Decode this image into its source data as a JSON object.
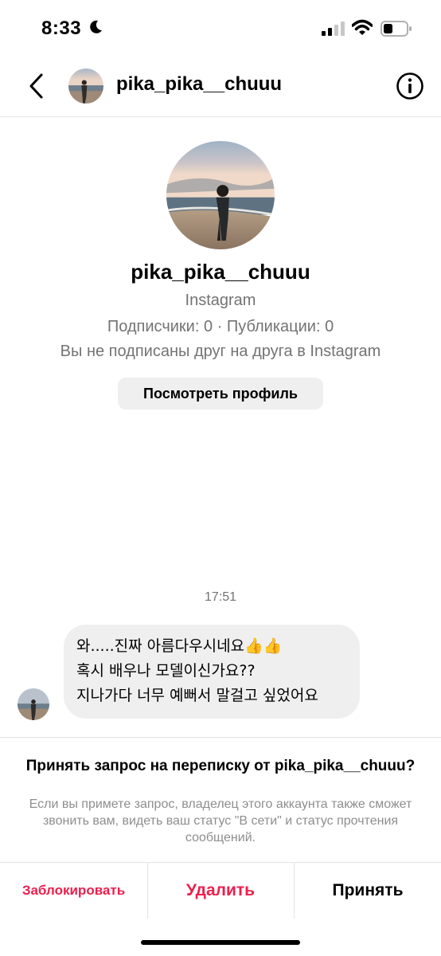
{
  "status_bar": {
    "time": "8:33",
    "icons": [
      "moon-icon",
      "cellular-signal-icon",
      "wifi-icon",
      "battery-icon"
    ]
  },
  "header": {
    "username": "pika_pika__chuuu",
    "icons": [
      "chevron-left-icon",
      "info-icon"
    ]
  },
  "profile": {
    "username": "pika_pika__chuuu",
    "platform": "Instagram",
    "stats": "Подписчики: 0 · Публикации: 0",
    "relation": "Вы не подписаны друг на друга в Instagram",
    "view_profile_label": "Посмотреть профиль"
  },
  "conversation": {
    "timestamp": "17:51",
    "message_lines": [
      "와.....진짜 아름다우시네요👍👍",
      "혹시 배우나 모델이신가요??",
      "지나가다 너무 예뻐서 말걸고 싶었어요"
    ]
  },
  "request_panel": {
    "title": "Принять запрос на переписку от pika_pika__chuuu?",
    "description": "Если вы примете запрос, владелец этого аккаунта также сможет звонить вам, видеть ваш статус \"В сети\" и статус прочтения сообщений.",
    "block_label": "Заблокировать",
    "delete_label": "Удалить",
    "accept_label": "Принять"
  },
  "colors": {
    "destructive": "#ed1f4d",
    "secondary_text": "#737373",
    "bubble_bg": "#efefef"
  }
}
